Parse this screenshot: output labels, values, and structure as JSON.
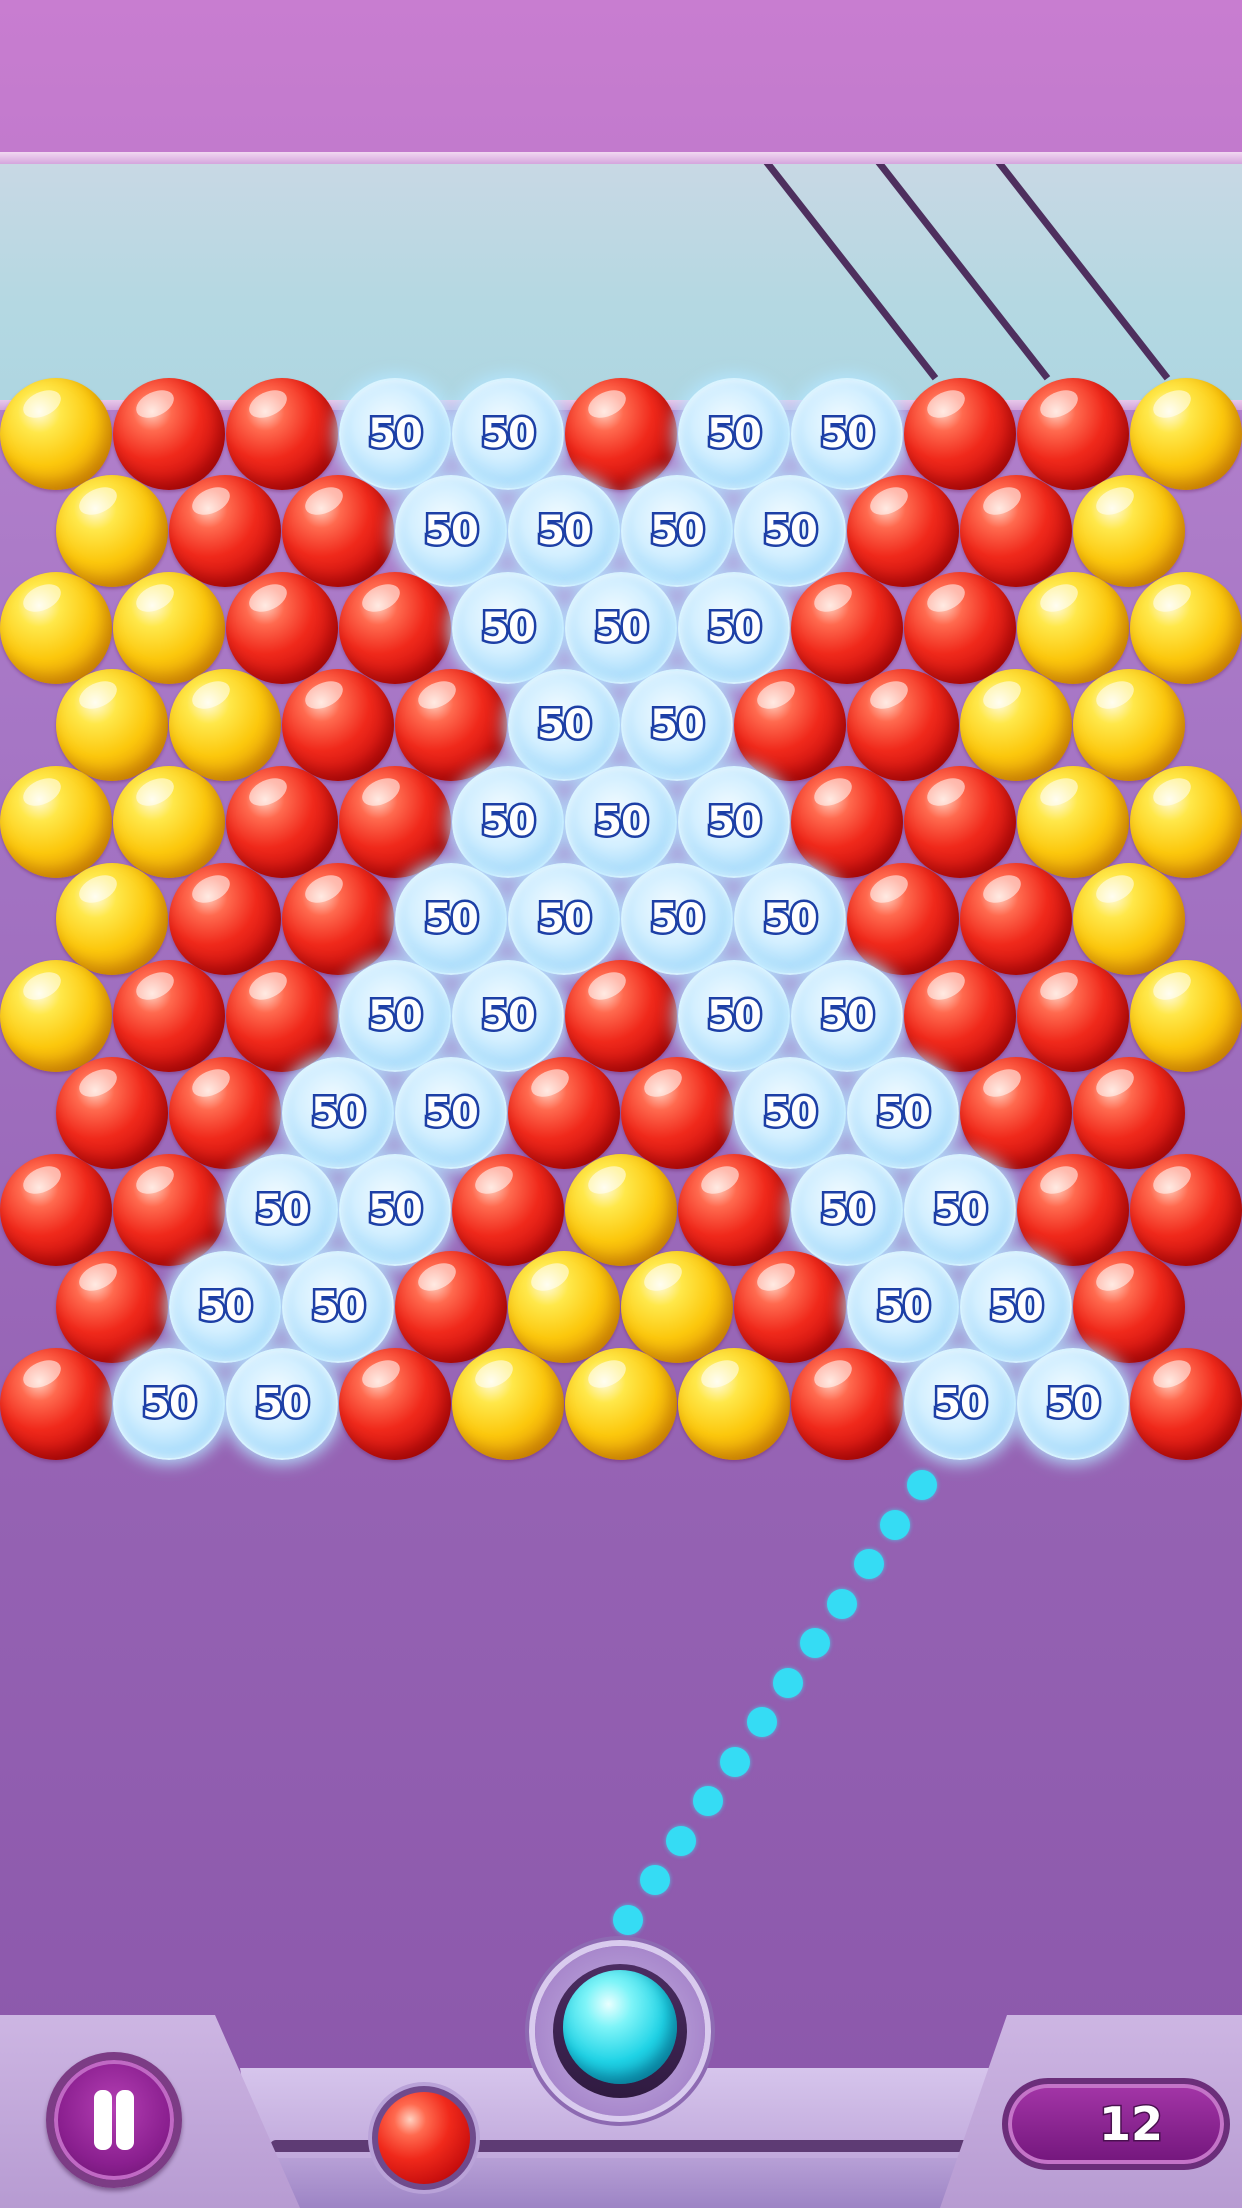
{
  "bubble_points_label": "50",
  "moves_left": "12",
  "current_bubble_color": "cyan",
  "next_bubble_color": "red",
  "colors": {
    "red": "#e8261a",
    "yellow": "#fcc80d",
    "points_bubble": "#bfe6fb",
    "aim_dots": "#35dcf4",
    "background": "#a474c4"
  },
  "grid": {
    "rows": [
      "YRRBBRBBRRY",
      "YRRBBBBRRY",
      "YYRRBBBRRYY",
      "YYRRBBRRYY",
      "YYRRBBBRRYY",
      "YRRBBBBRRY",
      "YRRBBRBBRRY",
      "RRBBRRBBRR",
      "RRBBRYRBBRR",
      "RBBRYYRBBR",
      "RBBRYYYRBBR"
    ]
  },
  "icons": [
    "pause-icon"
  ]
}
